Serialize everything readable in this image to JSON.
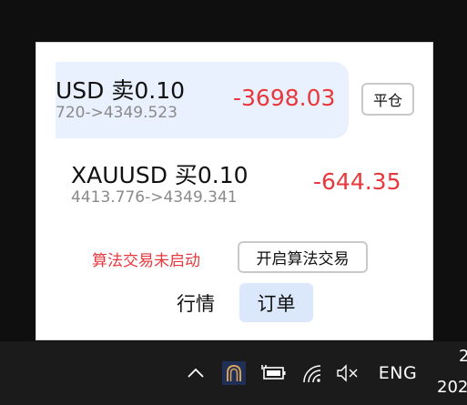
{
  "panel": {
    "orders": [
      {
        "symbol_text": "USD  卖0.10",
        "price_route": "720->4349.523",
        "pnl": "-3698.03",
        "close_label": "平仓"
      },
      {
        "symbol_text": "XAUUSD  买0.10",
        "price_route": "4413.776->4349.341",
        "pnl": "-644.35"
      }
    ],
    "algo_status": "算法交易未启动",
    "algo_button": "开启算法交易",
    "tabs": [
      {
        "label": "行情",
        "active": false
      },
      {
        "label": "订单",
        "active": true
      }
    ]
  },
  "taskbar": {
    "language": "ENG",
    "clock_line1": "2",
    "clock_line2": "202",
    "icons": [
      "chevron-up-icon",
      "app-tray-icon",
      "battery-plug-icon",
      "wifi-icon",
      "speaker-muted-icon"
    ]
  },
  "colors": {
    "negative": "#e8383d",
    "card_highlight": "#e9f1ff",
    "tab_active": "#dbe8fb",
    "taskbar": "#1b1b1b"
  }
}
